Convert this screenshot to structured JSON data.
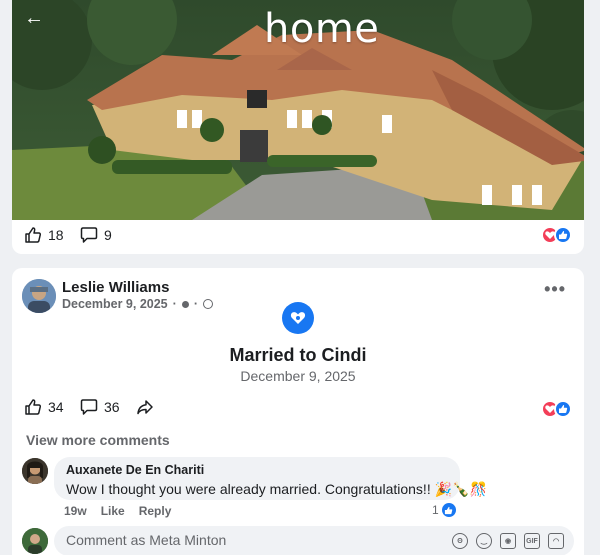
{
  "post1": {
    "image_overlay_text": "home",
    "likes": "18",
    "comments": "9"
  },
  "post2": {
    "author": "Leslie Williams",
    "date": "December 9, 2025",
    "event_title": "Married to Cindi",
    "event_date": "December 9, 2025",
    "likes": "34",
    "comments": "36",
    "view_more": "View more comments"
  },
  "comment": {
    "author": "Auxanete De En Chariti",
    "text": "Wow I thought you were already married. Congratulations!! 🎉🍾🎊",
    "time": "19w",
    "like_label": "Like",
    "reply_label": "Reply",
    "reaction_count": "1"
  },
  "composer": {
    "placeholder": "Comment as Meta Minton",
    "icons": [
      "sticker-icon",
      "emoji-icon",
      "camera-icon",
      "gif-icon",
      "avatar-sticker-icon"
    ]
  },
  "colors": {
    "accent": "#1877f2",
    "love": "#f33e58",
    "muted_text": "#65676b"
  }
}
